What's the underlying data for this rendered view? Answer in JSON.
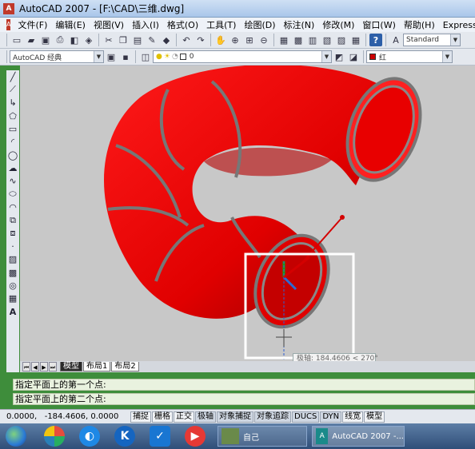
{
  "window": {
    "title": "AutoCAD 2007 - [F:\\CAD\\三维.dwg]"
  },
  "menu": [
    "文件(F)",
    "编辑(E)",
    "视图(V)",
    "插入(I)",
    "格式(O)",
    "工具(T)",
    "绘图(D)",
    "标注(N)",
    "修改(M)",
    "窗口(W)",
    "帮助(H)",
    "Express"
  ],
  "toolbar": {
    "text_style": "Standard",
    "workspace": "AutoCAD 经典",
    "layer": "0",
    "color": "红",
    "colors": {
      "accent_red": "#cc0000",
      "background": "#c8c8c8",
      "command_bg": "#e9f2df"
    }
  },
  "viewport": {
    "coord_tooltip": "极轴: 184.4606 < 270°"
  },
  "layout_tabs": [
    "模型",
    "布局1",
    "布局2"
  ],
  "command": {
    "line1": "指定平面上的第一个点:",
    "line2": "指定平面上的第二个点:"
  },
  "status": {
    "coords": "0.0000,   -184.4606, 0.0000",
    "buttons": [
      "捕捉",
      "栅格",
      "正交",
      "极轴",
      "对象捕捉",
      "对象追踪",
      "DUCS",
      "DYN",
      "线宽",
      "模型"
    ]
  },
  "taskbar": {
    "tasks": [
      "自己",
      "AutoCAD 2007 -..."
    ]
  }
}
